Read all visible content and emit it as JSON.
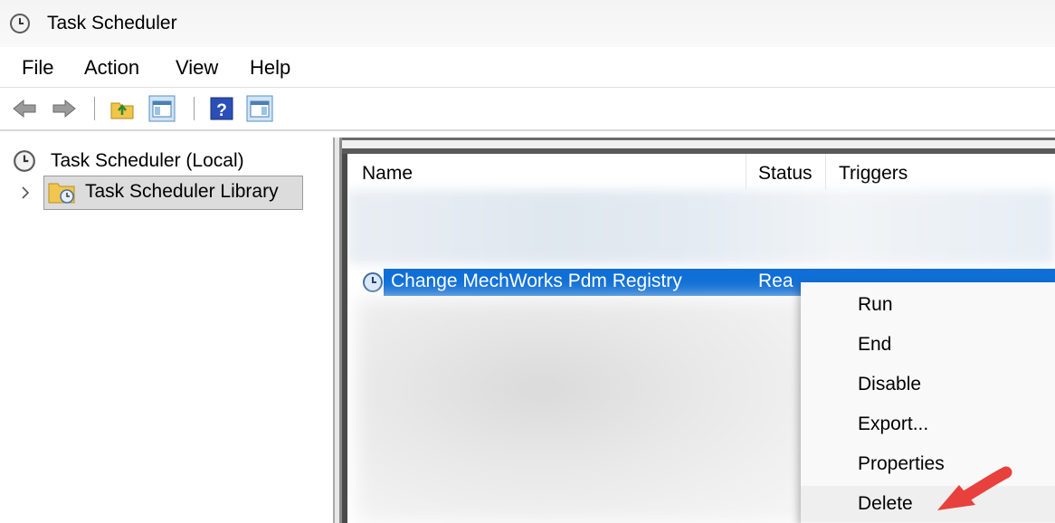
{
  "window": {
    "title": "Task Scheduler",
    "icon": "clock-icon"
  },
  "menubar": {
    "items": [
      "File",
      "Action",
      "View",
      "Help"
    ]
  },
  "toolbar": {
    "buttons": [
      "back-arrow-icon",
      "forward-arrow-icon",
      "up-folder-icon",
      "show-hide-console-tree-icon",
      "help-icon",
      "show-hide-action-pane-icon"
    ]
  },
  "tree": {
    "root_label": "Task Scheduler (Local)",
    "library_label": "Task Scheduler Library",
    "library_expanded": false
  },
  "task_list": {
    "columns": [
      "Name",
      "Status",
      "Triggers"
    ],
    "selected_row": {
      "name": "Change MechWorks Pdm Registry",
      "status": "Rea"
    }
  },
  "context_menu": {
    "items": [
      "Run",
      "End",
      "Disable",
      "Export...",
      "Properties",
      "Delete"
    ],
    "hovered": "Delete"
  },
  "colors": {
    "selection": "#0f6fd6",
    "annotation_arrow": "#e8403c"
  }
}
